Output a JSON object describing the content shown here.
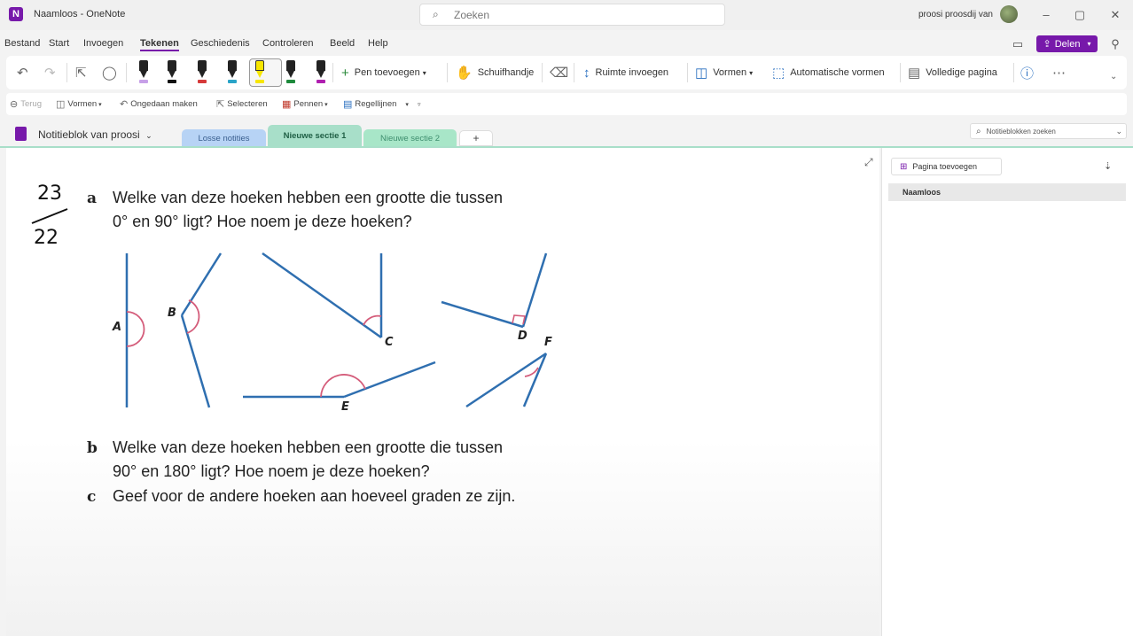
{
  "window": {
    "title": "Naamloos - OneNote",
    "search_placeholder": "Zoeken",
    "user": "proosi proosdij van",
    "min": "–",
    "max": "▢",
    "close": "✕"
  },
  "menu": {
    "tabs": [
      "Bestand",
      "Start",
      "Invoegen",
      "Tekenen",
      "Geschiedenis",
      "Controleren",
      "Beeld",
      "Help"
    ],
    "active": "Tekenen",
    "share": "Delen"
  },
  "ribbon": {
    "add_pen": "Pen toevoegen",
    "hand": "Schuifhandje",
    "insert_space": "Ruimte invoegen",
    "shapes": "Vormen",
    "auto_shapes": "Automatische vormen",
    "full_page": "Volledige pagina",
    "pens": [
      {
        "icon": "pen-icon",
        "color": "#c7a0e8"
      },
      {
        "icon": "pen-icon",
        "color": "#111111"
      },
      {
        "icon": "pen-icon",
        "color": "#d63a3a"
      },
      {
        "icon": "pen-icon",
        "color": "#2aa4c8"
      },
      {
        "icon": "highlighter-icon",
        "color": "#f7e600"
      },
      {
        "icon": "pen-icon",
        "color": "#1f8a3c"
      },
      {
        "icon": "pen-icon",
        "color": "#b01fb0"
      }
    ]
  },
  "quick": {
    "back": "Terug",
    "shapes": "Vormen",
    "undo": "Ongedaan maken",
    "select": "Selecteren",
    "pens": "Pennen",
    "rule_lines": "Regellijnen"
  },
  "notebook": {
    "name": "Notitieblok van proosi",
    "sections": [
      {
        "label": "Losse notities",
        "color": "#b7d3f5"
      },
      {
        "label": "Nieuwe sectie 1",
        "color": "#a8dfc9"
      },
      {
        "label": "Nieuwe sectie 2",
        "color": "#a8e6c8"
      }
    ],
    "add_section": "+",
    "search_placeholder": "Notitieblokken zoeken"
  },
  "canvas": {
    "handwriting_top": "23",
    "handwriting_bottom": "22",
    "q_a_letter": "a",
    "q_a_line1": "Welke van deze hoeken hebben een grootte die tussen",
    "q_a_line2": "0° en 90° ligt? Hoe noem je deze hoeken?",
    "q_b_letter": "b",
    "q_b_line1": "Welke van deze hoeken hebben een grootte die tussen",
    "q_b_line2": "90° en 180° ligt? Hoe noem je deze hoeken?",
    "q_c_letter": "c",
    "q_c_line1": "Geef voor de andere hoeken aan hoeveel graden ze zijn.",
    "angle_labels": [
      "A",
      "B",
      "C",
      "D",
      "E",
      "F"
    ],
    "line_color": "#2f6fb0",
    "arc_color": "#d45c7a"
  },
  "pages_pane": {
    "add_page": "Pagina toevoegen",
    "pages": [
      "Naamloos"
    ]
  }
}
